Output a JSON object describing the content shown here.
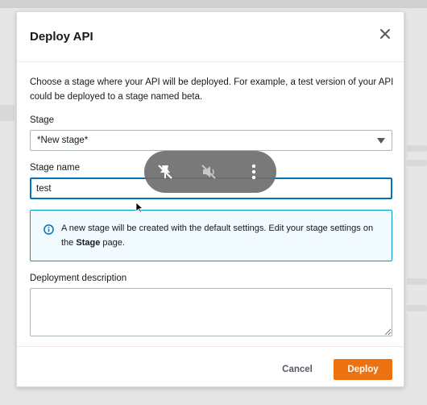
{
  "modal": {
    "title": "Deploy API",
    "description": "Choose a stage where your API will be deployed. For example, a test version of your API could be deployed to a stage named beta."
  },
  "stage": {
    "label": "Stage",
    "selected": "*New stage*"
  },
  "stage_name": {
    "label": "Stage name",
    "value": "test"
  },
  "info": {
    "text_before": "A new stage will be created with the default settings. Edit your stage settings on the ",
    "link": "Stage",
    "text_after": " page."
  },
  "deployment_description": {
    "label": "Deployment description",
    "value": ""
  },
  "buttons": {
    "cancel": "Cancel",
    "deploy": "Deploy"
  },
  "colors": {
    "primary": "#ec7211",
    "focus": "#0073bb",
    "info_border": "#00a1c9",
    "info_bg": "#f1faff"
  },
  "overlay_icons": [
    "unpin-icon",
    "mute-icon",
    "more-vertical-icon"
  ]
}
